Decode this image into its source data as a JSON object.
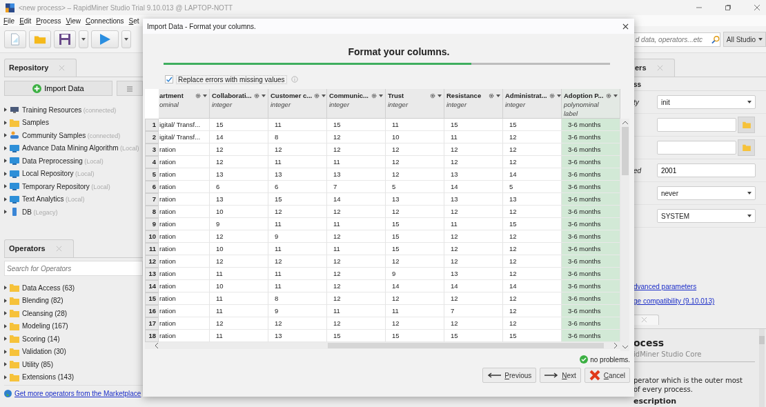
{
  "window": {
    "title": "<new process> – RapidMiner Studio Trial 9.10.013 @ LAPTOP-NOTT"
  },
  "menu": [
    {
      "label": "File"
    },
    {
      "label": "Edit"
    },
    {
      "label": "Process"
    },
    {
      "label": "View"
    },
    {
      "label": "Connections"
    },
    {
      "label": "Set"
    }
  ],
  "global_search": {
    "placeholder": "d data, operators...etc"
  },
  "scope_button": "All Studio",
  "repository": {
    "tab": "Repository",
    "import_button": "Import Data",
    "items": [
      {
        "name": "Training Resources",
        "tag": "(connected)",
        "kind": "training"
      },
      {
        "name": "Samples",
        "kind": "folder"
      },
      {
        "name": "Community Samples",
        "tag": "(connected)",
        "kind": "community"
      },
      {
        "name": "Advance Data Mining Algorithm",
        "tag": "(Local)",
        "kind": "repo"
      },
      {
        "name": "Data Preprocessing",
        "tag": "(Local)",
        "kind": "repo"
      },
      {
        "name": "Local Repository",
        "tag": "(Local)",
        "kind": "repo"
      },
      {
        "name": "Temporary Repository",
        "tag": "(Local)",
        "kind": "repo"
      },
      {
        "name": "Text Analytics",
        "tag": "(Local)",
        "kind": "repo"
      },
      {
        "name": "DB",
        "tag": "(Legacy)",
        "kind": "db"
      }
    ]
  },
  "operators": {
    "tab": "Operators",
    "search": {
      "placeholder": "Search for Operators"
    },
    "items": [
      {
        "name": "Data Access (63)"
      },
      {
        "name": "Blending (82)"
      },
      {
        "name": "Cleansing (28)"
      },
      {
        "name": "Modeling (167)"
      },
      {
        "name": "Scoring (14)"
      },
      {
        "name": "Validation (30)"
      },
      {
        "name": "Utility (85)"
      },
      {
        "name": "Extensions (143)"
      }
    ],
    "marketplace_link": "Get more operators from the Marketplace"
  },
  "parameters": {
    "tab": "ers",
    "heading": "ss",
    "rows": [
      {
        "label": "ty",
        "kind": "dropdown",
        "value": "init"
      },
      {
        "kind": "file"
      },
      {
        "kind": "file"
      },
      {
        "label": "ed",
        "kind": "text",
        "value": "2001"
      },
      {
        "kind": "dropdown",
        "value": "never"
      },
      {
        "kind": "dropdown",
        "value": "SYSTEM"
      }
    ],
    "links": [
      "dvanced parameters",
      "ge compatibility (9.10.013)"
    ]
  },
  "help": {
    "title": "ocess",
    "subtitle": "idMiner Studio Core",
    "lines": [
      "perator which is the outer most",
      "of every process."
    ],
    "section": "escription"
  },
  "dialog": {
    "title": "Import Data - Format your columns.",
    "heading": "Format your columns.",
    "progress": {
      "level": 0.69
    },
    "replace_errors": {
      "label": "Replace errors with missing values",
      "checked": true
    },
    "table": {
      "columns": [
        {
          "name": "artment",
          "type": "ominal",
          "kind": "attribute"
        },
        {
          "name": "Collaborati...",
          "type": "integer",
          "kind": "attribute"
        },
        {
          "name": "Customer c...",
          "type": "integer",
          "kind": "attribute"
        },
        {
          "name": "Communic...",
          "type": "integer",
          "kind": "attribute"
        },
        {
          "name": "Trust",
          "type": "integer",
          "kind": "attribute"
        },
        {
          "name": "Resistance",
          "type": "integer",
          "kind": "attribute"
        },
        {
          "name": "Administrat...",
          "type": "integer",
          "kind": "attribute"
        },
        {
          "name": "Adoption P...",
          "type": "polynominal",
          "role": "label",
          "kind": "label"
        }
      ],
      "rows": [
        {
          "num": "1",
          "cells": [
            "igital/ Transf...",
            "15",
            "11",
            "15",
            "11",
            "15",
            "15",
            "3-6 months"
          ]
        },
        {
          "num": "2",
          "cells": [
            "igital/ Transf...",
            "14",
            "8",
            "12",
            "10",
            "11",
            "12",
            "3-6 months"
          ]
        },
        {
          "num": "3",
          "cells": [
            "ration",
            "12",
            "12",
            "12",
            "12",
            "12",
            "12",
            "3-6 months"
          ]
        },
        {
          "num": "4",
          "cells": [
            "ration",
            "12",
            "11",
            "11",
            "12",
            "12",
            "12",
            "3-6 months"
          ]
        },
        {
          "num": "5",
          "cells": [
            "ration",
            "13",
            "13",
            "13",
            "12",
            "13",
            "14",
            "3-6 months"
          ]
        },
        {
          "num": "6",
          "cells": [
            "ration",
            "6",
            "6",
            "7",
            "5",
            "14",
            "5",
            "3-6 months"
          ]
        },
        {
          "num": "7",
          "cells": [
            "ration",
            "13",
            "15",
            "14",
            "13",
            "13",
            "13",
            "3-6 months"
          ]
        },
        {
          "num": "8",
          "cells": [
            "ration",
            "10",
            "12",
            "12",
            "12",
            "12",
            "12",
            "3-6 months"
          ]
        },
        {
          "num": "9",
          "cells": [
            "ration",
            "9",
            "11",
            "11",
            "15",
            "11",
            "15",
            "3-6 months"
          ]
        },
        {
          "num": "10",
          "cells": [
            "ration",
            "12",
            "9",
            "12",
            "15",
            "12",
            "12",
            "3-6 months"
          ]
        },
        {
          "num": "11",
          "cells": [
            "ration",
            "10",
            "11",
            "11",
            "15",
            "12",
            "12",
            "3-6 months"
          ]
        },
        {
          "num": "12",
          "cells": [
            "ration",
            "12",
            "12",
            "12",
            "12",
            "12",
            "12",
            "3-6 months"
          ]
        },
        {
          "num": "13",
          "cells": [
            "ration",
            "11",
            "11",
            "12",
            "9",
            "13",
            "12",
            "3-6 months"
          ]
        },
        {
          "num": "14",
          "cells": [
            "ration",
            "10",
            "11",
            "12",
            "14",
            "14",
            "14",
            "3-6 months"
          ]
        },
        {
          "num": "15",
          "cells": [
            "ration",
            "11",
            "8",
            "12",
            "12",
            "12",
            "12",
            "3-6 months"
          ]
        },
        {
          "num": "16",
          "cells": [
            "ration",
            "11",
            "9",
            "11",
            "11",
            "7",
            "12",
            "3-6 months"
          ]
        },
        {
          "num": "17",
          "cells": [
            "ration",
            "12",
            "12",
            "12",
            "12",
            "12",
            "12",
            "3-6 months"
          ]
        },
        {
          "num": "18",
          "cells": [
            "ration",
            "11",
            "13",
            "15",
            "15",
            "15",
            "15",
            "3-6 months"
          ]
        }
      ]
    },
    "status": "no problems.",
    "buttons": [
      {
        "label": "Previous",
        "kind": "previous"
      },
      {
        "label": "Next",
        "kind": "next"
      },
      {
        "label": "Cancel",
        "kind": "cancel"
      }
    ]
  }
}
